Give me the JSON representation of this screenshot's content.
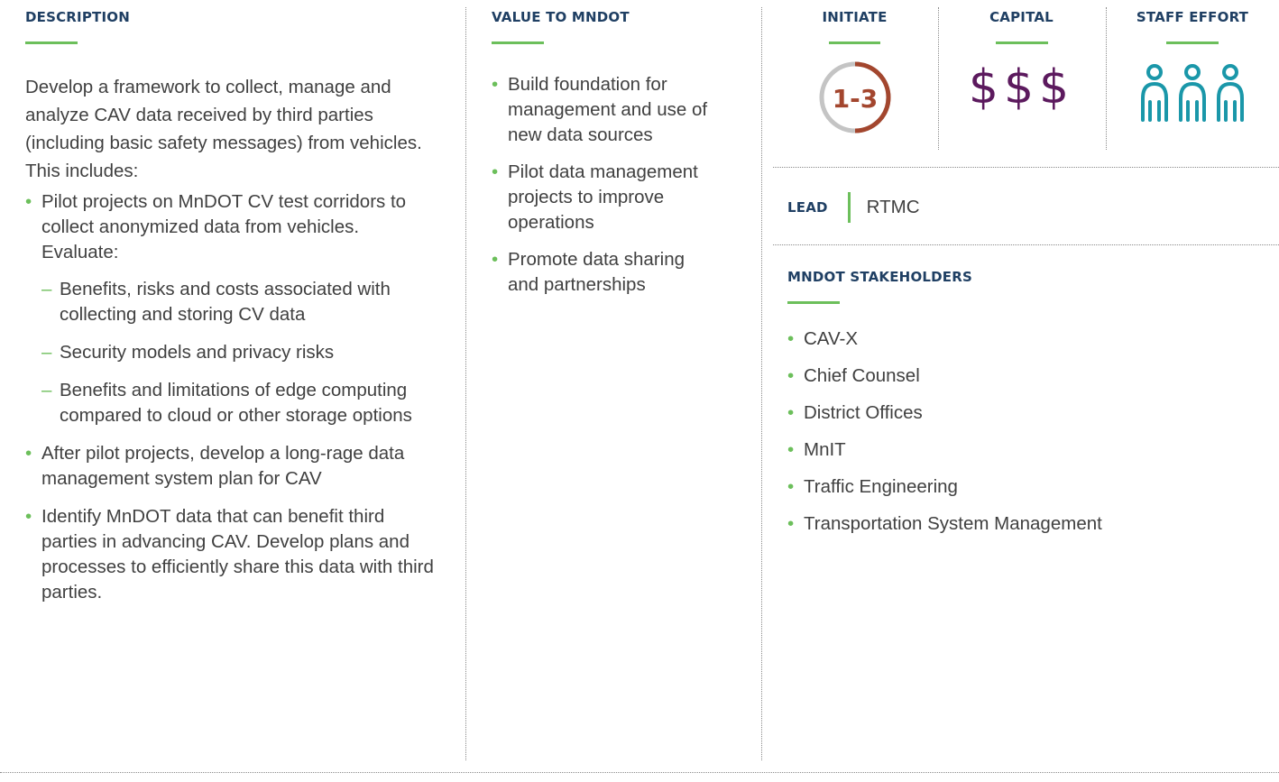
{
  "description": {
    "heading": "DESCRIPTION",
    "intro": "Develop a framework to collect, manage and analyze CAV data received by third parties (including basic safety messages) from vehicles. This includes:",
    "bullets": [
      {
        "text": "Pilot projects on MnDOT CV test corridors to collect anonymized data from vehicles. Evaluate:",
        "sub": [
          "Benefits, risks and costs associated with collecting and storing CV data",
          "Security models and privacy risks",
          "Benefits and limitations of edge computing compared to cloud or other storage options"
        ]
      },
      {
        "text": "After pilot projects, develop a long-rage data management system plan for CAV"
      },
      {
        "text": "Identify MnDOT data that can benefit third parties in advancing CAV. Develop plans and processes to efficiently share this data with third parties."
      }
    ]
  },
  "value": {
    "heading": "VALUE TO MNDOT",
    "bullets": [
      "Build foundation for management and use of new data sources",
      "Pilot data management projects to improve operations",
      "Promote data sharing and partnerships"
    ]
  },
  "initiate": {
    "heading": "INITIATE",
    "value": "1-3",
    "progress_fraction": 0.5
  },
  "capital": {
    "heading": "CAPITAL",
    "symbols": "$$$"
  },
  "staff_effort": {
    "heading": "STAFF EFFORT",
    "count": 3
  },
  "lead": {
    "label": "LEAD",
    "value": "RTMC"
  },
  "stakeholders": {
    "heading": "MNDOT STAKEHOLDERS",
    "items": [
      "CAV-X",
      "Chief Counsel",
      "District Offices",
      "MnIT",
      "Traffic Engineering",
      "Transportation System Management"
    ]
  },
  "colors": {
    "heading": "#1f3f63",
    "accent": "#6cbf5b",
    "ring": "#a3462e",
    "capital": "#5c1a5e",
    "staff": "#1a97a9"
  }
}
